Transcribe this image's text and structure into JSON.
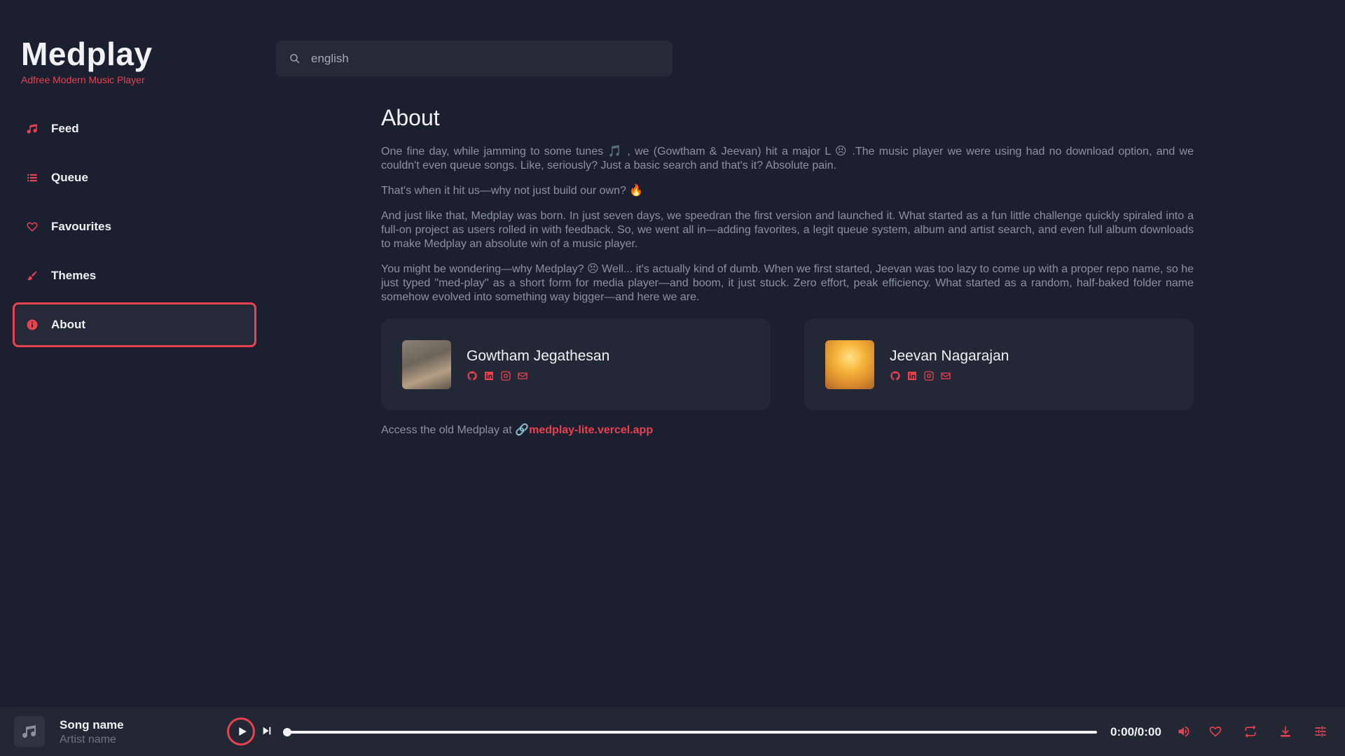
{
  "brand": {
    "title": "Medplay",
    "subtitle": "Adfree Modern Music Player"
  },
  "search": {
    "value": "english",
    "icon": "search-icon"
  },
  "sidebar": {
    "items": [
      {
        "label": "Feed",
        "icon": "music-note-icon",
        "active": false
      },
      {
        "label": "Queue",
        "icon": "list-icon",
        "active": false
      },
      {
        "label": "Favourites",
        "icon": "heart-icon",
        "active": false
      },
      {
        "label": "Themes",
        "icon": "brush-icon",
        "active": false
      },
      {
        "label": "About",
        "icon": "info-icon",
        "active": true
      }
    ]
  },
  "about": {
    "title": "About",
    "paragraphs": [
      "One fine day, while jamming to some tunes 🎵 , we (Gowtham & Jeevan) hit a major L 😣 .The music player we were using had no download option, and we couldn't even queue songs. Like, seriously? Just a basic search and that's it? Absolute pain.",
      "That's when it hit us—why not just build our own? 🔥",
      "And just like that, Medplay was born. In just seven days, we speedran the first version and launched it. What started as a fun little challenge quickly spiraled into a full-on project as users rolled in with feedback. So, we went all in—adding favorites, a legit queue system, album and artist search, and even full album downloads to make Medplay an absolute win of a music player.",
      "You might be wondering—why Medplay? 😣 Well... it's actually kind of dumb. When we first started, Jeevan was too lazy to come up with a proper repo name, so he just typed \"med-play\" as a short form for media player—and boom, it just stuck. Zero effort, peak efficiency. What started as a random, half-baked folder name somehow evolved into something way bigger—and here we are."
    ],
    "creators": [
      {
        "name": "Gowtham Jegathesan",
        "socials": [
          "github-icon",
          "linkedin-icon",
          "instagram-icon",
          "mail-icon"
        ]
      },
      {
        "name": "Jeevan Nagarajan",
        "socials": [
          "github-icon",
          "linkedin-icon",
          "instagram-icon",
          "mail-icon"
        ]
      }
    ],
    "old_link_prefix": "Access the old Medplay at ",
    "old_link_text": "medplay-lite.vercel.app"
  },
  "player": {
    "song_name": "Song name",
    "artist_name": "Artist name",
    "time": "0:00/0:00",
    "progress": 0,
    "accent": "#e8414f"
  }
}
